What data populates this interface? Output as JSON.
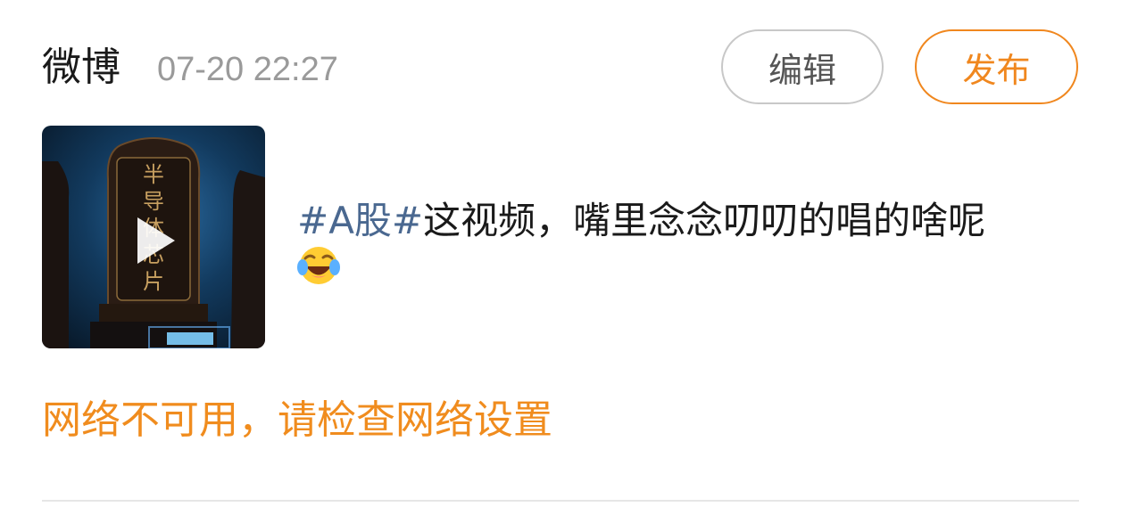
{
  "header": {
    "source": "微博",
    "timestamp": "07-20 22:27",
    "edit_label": "编辑",
    "publish_label": "发布"
  },
  "post": {
    "thumbnail_icon": "play-icon",
    "thumbnail_caption": "半导体芯片",
    "hashtag": "#A股#",
    "text": "这视频，嘴里念念叨叨的唱的啥呢",
    "emoji_icon": "laughing-tears-emoji"
  },
  "status": {
    "network_message": "网络不可用，请检查网络设置"
  },
  "colors": {
    "accent": "#f0871e",
    "hashtag": "#4a6890",
    "timestamp": "#9a9a9a"
  }
}
